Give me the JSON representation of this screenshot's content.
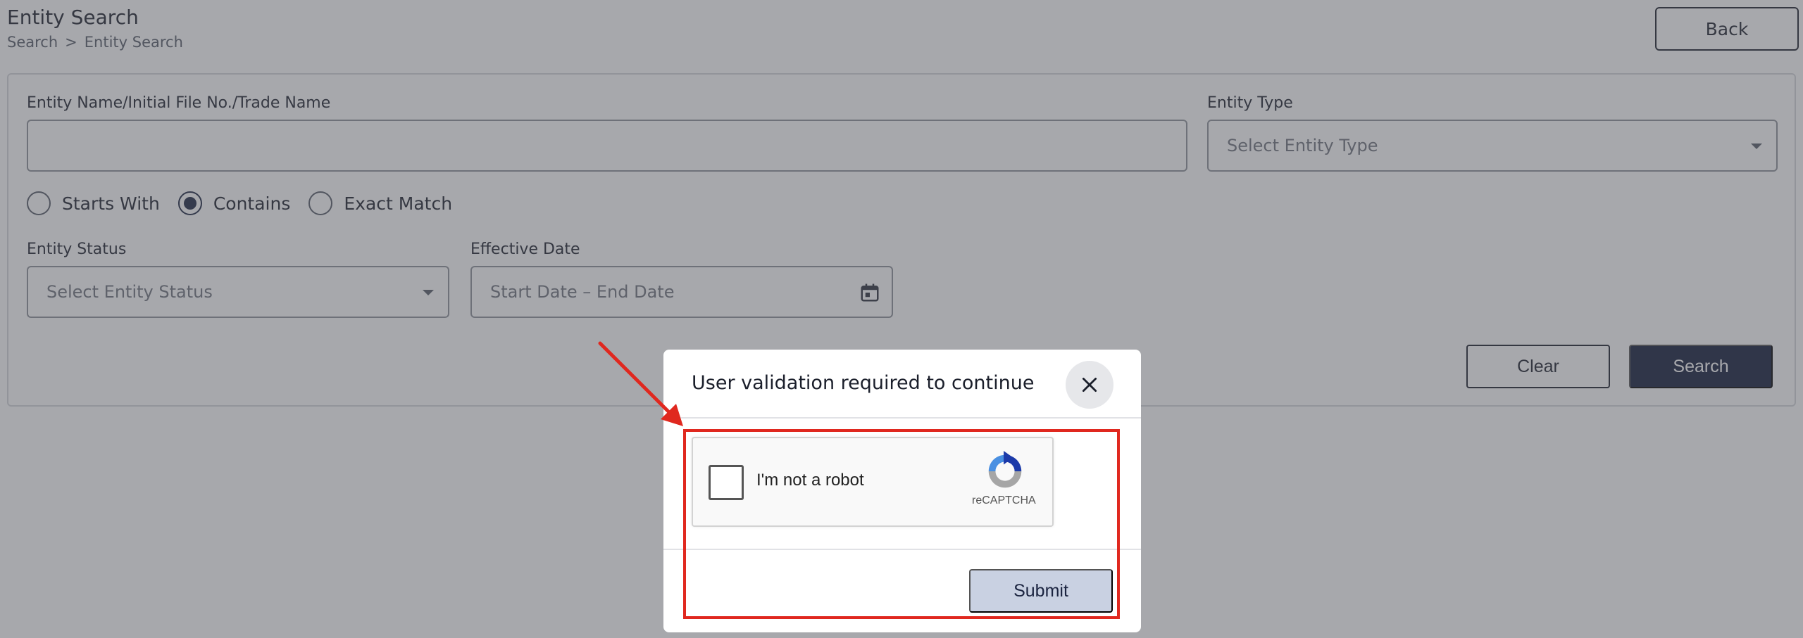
{
  "header": {
    "title": "Entity Search",
    "breadcrumb": [
      "Search",
      ">",
      "Entity Search"
    ],
    "back_label": "Back"
  },
  "form": {
    "name_label": "Entity Name/Initial File No./Trade Name",
    "name_value": "",
    "type_label": "Entity Type",
    "type_placeholder": "Select Entity Type",
    "match_options": [
      {
        "label": "Starts With",
        "checked": false
      },
      {
        "label": "Contains",
        "checked": true
      },
      {
        "label": "Exact Match",
        "checked": false
      }
    ],
    "status_label": "Entity Status",
    "status_placeholder": "Select Entity Status",
    "date_label": "Effective Date",
    "date_placeholder": "Start Date – End Date",
    "clear_label": "Clear",
    "search_label": "Search"
  },
  "modal": {
    "title": "User validation required to continue",
    "recaptcha_label": "I'm not a robot",
    "recaptcha_brand": "reCAPTCHA",
    "submit_label": "Submit"
  },
  "colors": {
    "primary": "#101a38",
    "annotation": "#e0281f",
    "submit_disabled": "#c9d1e2"
  },
  "icons": {
    "calendar": "calendar-icon",
    "close": "close-icon",
    "dropdown": "chevron-down-icon",
    "recaptcha": "recaptcha-logo-icon",
    "annotation_arrow": "arrow-icon"
  }
}
